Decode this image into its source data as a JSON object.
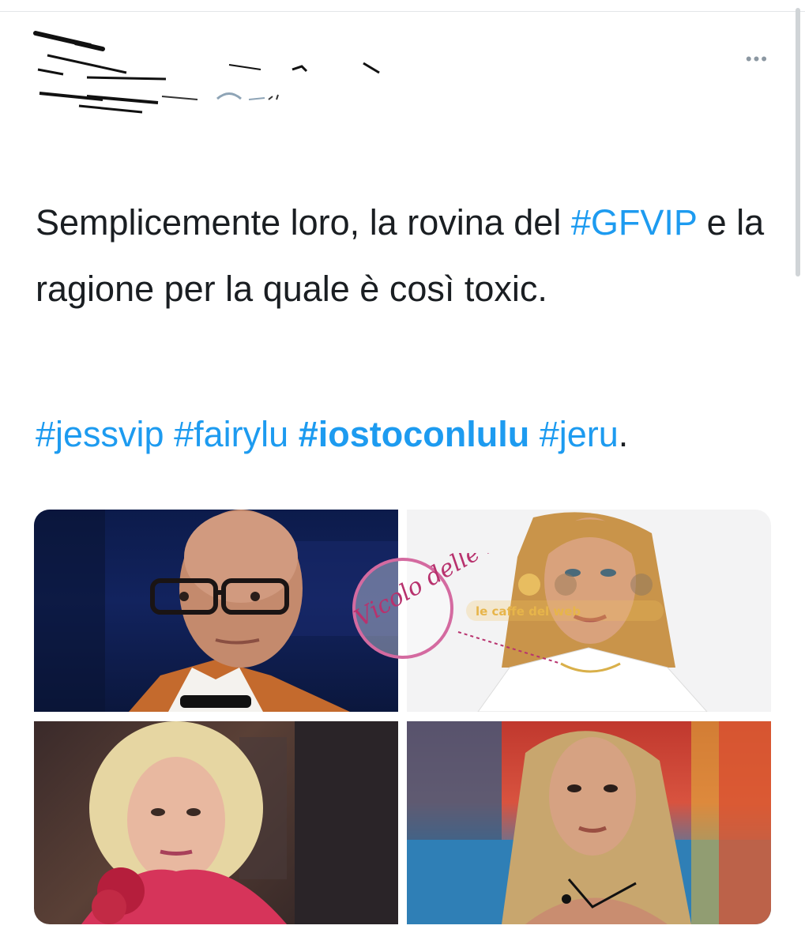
{
  "header": {
    "more_icon": "more-horizontal-icon",
    "more_glyph": "•••"
  },
  "tweet": {
    "text_part1": "Semplicemente loro, la rovina del ",
    "hashtag_main": "#GFVIP",
    "text_part2": " e la ragione per la quale è così toxic.",
    "tags": [
      {
        "label": "#jessvip",
        "bold": false
      },
      {
        "label": "#fairylu",
        "bold": false
      },
      {
        "label": "#iostoconlulu",
        "bold": true
      },
      {
        "label": "#jeru",
        "bold": false
      }
    ],
    "tags_end": "."
  },
  "media": [
    {
      "name": "photo-1"
    },
    {
      "name": "photo-2"
    },
    {
      "name": "photo-3"
    },
    {
      "name": "photo-4"
    }
  ],
  "watermark": {
    "logo_text": "Vicolo delle News",
    "banner_text": "le caffe del web"
  },
  "colors": {
    "accent": "#1d9bf0",
    "text": "#1a1e22",
    "muted": "#8c98a2"
  }
}
